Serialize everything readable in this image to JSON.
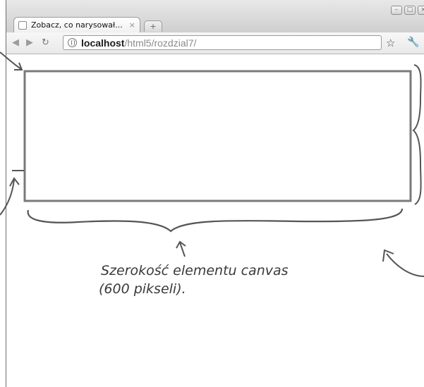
{
  "browser": {
    "tab_title": "Zobacz, co narysował...",
    "tab_close": "×",
    "new_tab": "+",
    "url_host": "localhost",
    "url_path": "/html5/rozdzial7/",
    "window_controls": [
      "–",
      "□",
      "×"
    ]
  },
  "annotation": {
    "line1": "Szerokość elementu canvas",
    "line2": "(600 pikseli)."
  },
  "icons": [
    "back-icon",
    "forward-icon",
    "reload-icon",
    "globe-icon",
    "star-icon",
    "wrench-icon"
  ]
}
